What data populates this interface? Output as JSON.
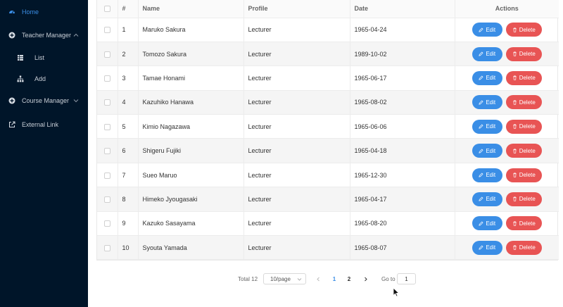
{
  "sidebar": {
    "items": [
      {
        "label": "Home",
        "icon": "dashboard-icon"
      },
      {
        "label": "Teacher Manager",
        "icon": "plus-circle-icon"
      },
      {
        "label": "List",
        "icon": "grid-icon"
      },
      {
        "label": "Add",
        "icon": "sitemap-icon"
      },
      {
        "label": "Course Manager",
        "icon": "plus-circle-icon"
      },
      {
        "label": "External Link",
        "icon": "external-link-icon"
      }
    ]
  },
  "table": {
    "headers": {
      "index": "#",
      "name": "Name",
      "profile": "Profile",
      "date": "Date",
      "actions": "Actions"
    },
    "edit_label": "Edit",
    "delete_label": "Delete",
    "rows": [
      {
        "index": "1",
        "name": "Maruko Sakura",
        "profile": "Lecturer",
        "date": "1965-04-24"
      },
      {
        "index": "2",
        "name": "Tomozo Sakura",
        "profile": "Lecturer",
        "date": "1989-10-02"
      },
      {
        "index": "3",
        "name": "Tamae Honami",
        "profile": "Lecturer",
        "date": "1965-06-17"
      },
      {
        "index": "4",
        "name": "Kazuhiko Hanawa",
        "profile": "Lecturer",
        "date": "1965-08-02"
      },
      {
        "index": "5",
        "name": "Kimio Nagazawa",
        "profile": "Lecturer",
        "date": "1965-06-06"
      },
      {
        "index": "6",
        "name": "Shigeru Fujiki",
        "profile": "Lecturer",
        "date": "1965-04-18"
      },
      {
        "index": "7",
        "name": "Sueo Maruo",
        "profile": "Lecturer",
        "date": "1965-12-30"
      },
      {
        "index": "8",
        "name": "Himeko Jyougasaki",
        "profile": "Lecturer",
        "date": "1965-04-17"
      },
      {
        "index": "9",
        "name": "Kazuko Sasayama",
        "profile": "Lecturer",
        "date": "1965-08-20"
      },
      {
        "index": "10",
        "name": "Syouta Yamada",
        "profile": "Lecturer",
        "date": "1965-08-07"
      }
    ]
  },
  "pagination": {
    "total_text": "Total 12",
    "page_size": "10/page",
    "pages": [
      "1",
      "2"
    ],
    "current_page": "1",
    "goto_label": "Go to",
    "goto_value": "1"
  },
  "colors": {
    "sidebar_bg": "#001529",
    "accent": "#3a8ee6",
    "danger": "#e85454"
  }
}
